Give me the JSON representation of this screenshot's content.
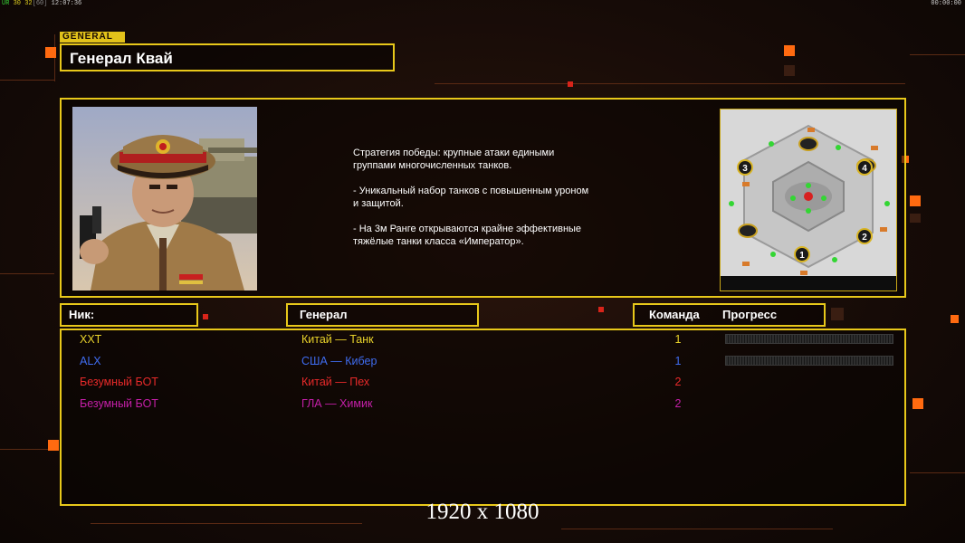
{
  "topbar": {
    "left_prefix": "UR",
    "left_nums_a": "30",
    "left_nums_b": "32",
    "left_bracket": "[60]",
    "left_time": "12:07:36",
    "right_time": "00:00:00"
  },
  "header": {
    "tag": "GENERAL",
    "title": "Генерал Квай"
  },
  "description": {
    "p1": "Стратегия победы: крупные атаки едиными\n группами многочисленных танков.",
    "p2": "- Уникальный набор танков с повышенным уроном\n  и защитой.",
    "p3": "- На 3м Ранге открываются крайне эффективные\n  тяжёлые танки класса «Император»."
  },
  "minimap": {
    "spawn_labels": [
      "3",
      "4",
      "2",
      "1"
    ]
  },
  "columns": {
    "nick": "Ник:",
    "general": "Генерал",
    "team": "Команда",
    "progress": "Прогресс"
  },
  "players": [
    {
      "nick": "XXT",
      "general": "Китай — Танк",
      "team": "1",
      "color": "#e8d22a",
      "progress": 0
    },
    {
      "nick": "ALX",
      "general": "США — Кибер",
      "team": "1",
      "color": "#3f6cf0",
      "progress": 0
    },
    {
      "nick": "Безумный БОТ",
      "general": "Китай — Пех",
      "team": "2",
      "color": "#e82a2a"
    },
    {
      "nick": "Безумный БОТ",
      "general": "ГЛА — Химик",
      "team": "2",
      "color": "#c51fa8"
    }
  ],
  "resolution_text": "1920 x 1080",
  "colors": {
    "accent": "#e8c81a",
    "deco_orange": "#ff6a10"
  }
}
